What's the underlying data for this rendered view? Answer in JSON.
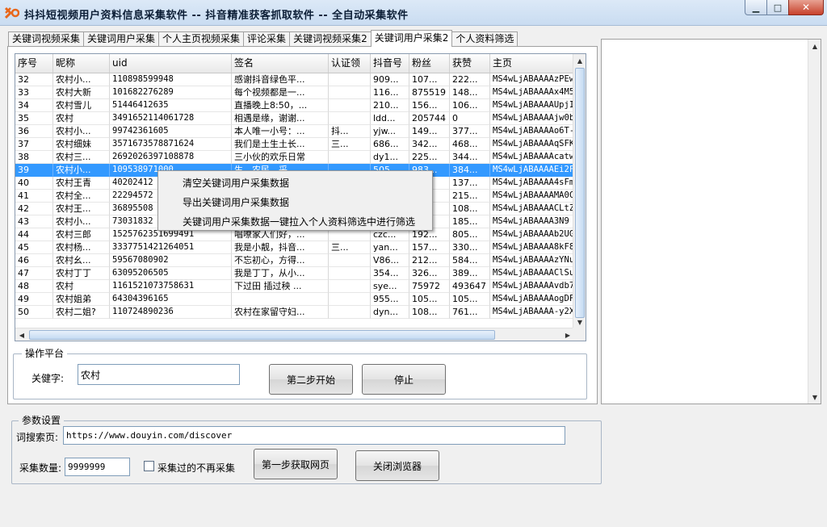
{
  "window": {
    "title": "抖抖短视频用户资料信息采集软件 -- 抖音精准获客抓取软件 -- 全自动采集软件",
    "min": "▁",
    "max": "□",
    "close": "✕"
  },
  "tabs": [
    {
      "label": "关键词视频采集"
    },
    {
      "label": "关键词用户采集"
    },
    {
      "label": "个人主页视频采集"
    },
    {
      "label": "评论采集"
    },
    {
      "label": "关键词视频采集2"
    },
    {
      "label": "关键词用户采集2",
      "active": true
    },
    {
      "label": "个人资料筛选"
    }
  ],
  "grid": {
    "headers": [
      "序号",
      "昵称",
      "uid",
      "签名",
      "认证领",
      "抖音号",
      "粉丝",
      "获赞",
      "主页"
    ],
    "rows": [
      [
        "32",
        "农村小...",
        "110898599948",
        "感谢抖音绿色平...",
        "",
        "909...",
        "107...",
        "222...",
        "MS4wLjABAAAAzPEw"
      ],
      [
        "33",
        "农村大新",
        "101682276289",
        "每个视频都是一...",
        "",
        "116...",
        "875519",
        "148...",
        "MS4wLjABAAAAx4M5"
      ],
      [
        "34",
        "农村雪儿",
        "51446412635",
        "直播晚上8:50，...",
        "",
        "210...",
        "156...",
        "106...",
        "MS4wLjABAAAAUpjI"
      ],
      [
        "35",
        "农村",
        "3491652114061728",
        "相遇是缘，谢谢...",
        "",
        "ldd...",
        "205744",
        "0",
        "MS4wLjABAAAAjw0b"
      ],
      [
        "36",
        "农村小...",
        "99742361605",
        "本人唯一小号：...",
        "抖...",
        "yjw...",
        "149...",
        "377...",
        "MS4wLjABAAAAo6T-"
      ],
      [
        "37",
        "农村细妹",
        "3571673578871624",
        "我们是土生土长...",
        "三...",
        "686...",
        "342...",
        "468...",
        "MS4wLjABAAAAqSFK"
      ],
      [
        "38",
        "农村三...",
        "2692026397108878",
        "三小伙的欢乐日常",
        "",
        "dy1...",
        "225...",
        "344...",
        "MS4wLjABAAAAcatw"
      ],
      [
        "39",
        "农村小...",
        "109538971000",
        "生，农民，采...",
        "",
        "505...",
        "983...",
        "384...",
        "MS4wLjABAAAAEi2F"
      ],
      [
        "40",
        "农村王青",
        "40202412",
        "",
        "",
        "",
        "",
        "137...",
        "MS4wLjABAAAA4sFm"
      ],
      [
        "41",
        "农村全...",
        "22294572",
        "",
        "",
        "",
        "",
        "215...",
        "MS4wLjABAAAAMA0C"
      ],
      [
        "42",
        "农村王...",
        "36895508",
        "",
        "",
        "",
        "",
        "108...",
        "MS4wLjABAAAACLtZ"
      ],
      [
        "43",
        "农村小...",
        "73031832",
        "",
        "",
        "",
        "",
        "185...",
        "MS4wLjABAAAA3N9"
      ],
      [
        "44",
        "农村三郎",
        "1525762351699491",
        "唱嘹家人们好，...",
        "",
        "czc...",
        "192...",
        "805...",
        "MS4wLjABAAAAb2UG"
      ],
      [
        "45",
        "农村杨...",
        "3337751421264051",
        "我是小靓，抖音...",
        "三...",
        "yan...",
        "157...",
        "330...",
        "MS4wLjABAAAA8kF8"
      ],
      [
        "46",
        "农村幺...",
        "59567080902",
        "不忘初心，方得...",
        "",
        "V86...",
        "212...",
        "584...",
        "MS4wLjABAAAAzYNu"
      ],
      [
        "47",
        "农村丁丁",
        "63095206505",
        "我是丁丁，从小...",
        "",
        "354...",
        "326...",
        "389...",
        "MS4wLjABAAAAClSu"
      ],
      [
        "48",
        "农村",
        "1161521073758631",
        "下过田 插过秧 ...",
        "",
        "sye...",
        "75972",
        "493647",
        "MS4wLjABAAAAvdb7"
      ],
      [
        "49",
        "农村姐弟",
        "64304396165",
        "",
        "",
        "955...",
        "105...",
        "105...",
        "MS4wLjABAAAAogDF"
      ],
      [
        "50",
        "农村二姐?",
        "110724890236",
        "农村在家留守妇...",
        "",
        "dyn...",
        "108...",
        "761...",
        "MS4wLjABAAAA-y2X"
      ]
    ],
    "selected_index": 7
  },
  "context_menu": {
    "items": [
      "清空关键词用户采集数据",
      "导出关键词用户采集数据",
      "关键词用户采集数据一键拉入个人资料筛选中进行筛选"
    ]
  },
  "operation": {
    "title": "操作平台",
    "keyword_label": "关健字:",
    "keyword_value": "农村",
    "start_label": "第二步开始",
    "stop_label": "停止"
  },
  "params": {
    "title": "参数设置",
    "url_label": "词搜索页:",
    "url_value": "https://www.douyin.com/discover",
    "count_label": "采集数量:",
    "count_value": "9999999",
    "skip_label": "采集过的不再采集",
    "fetch_label": "第一步获取网页",
    "close_browser_label": "关闭浏览器"
  },
  "colors": {
    "selection": "#3399ff",
    "titlebar": "#c9dcf1"
  }
}
